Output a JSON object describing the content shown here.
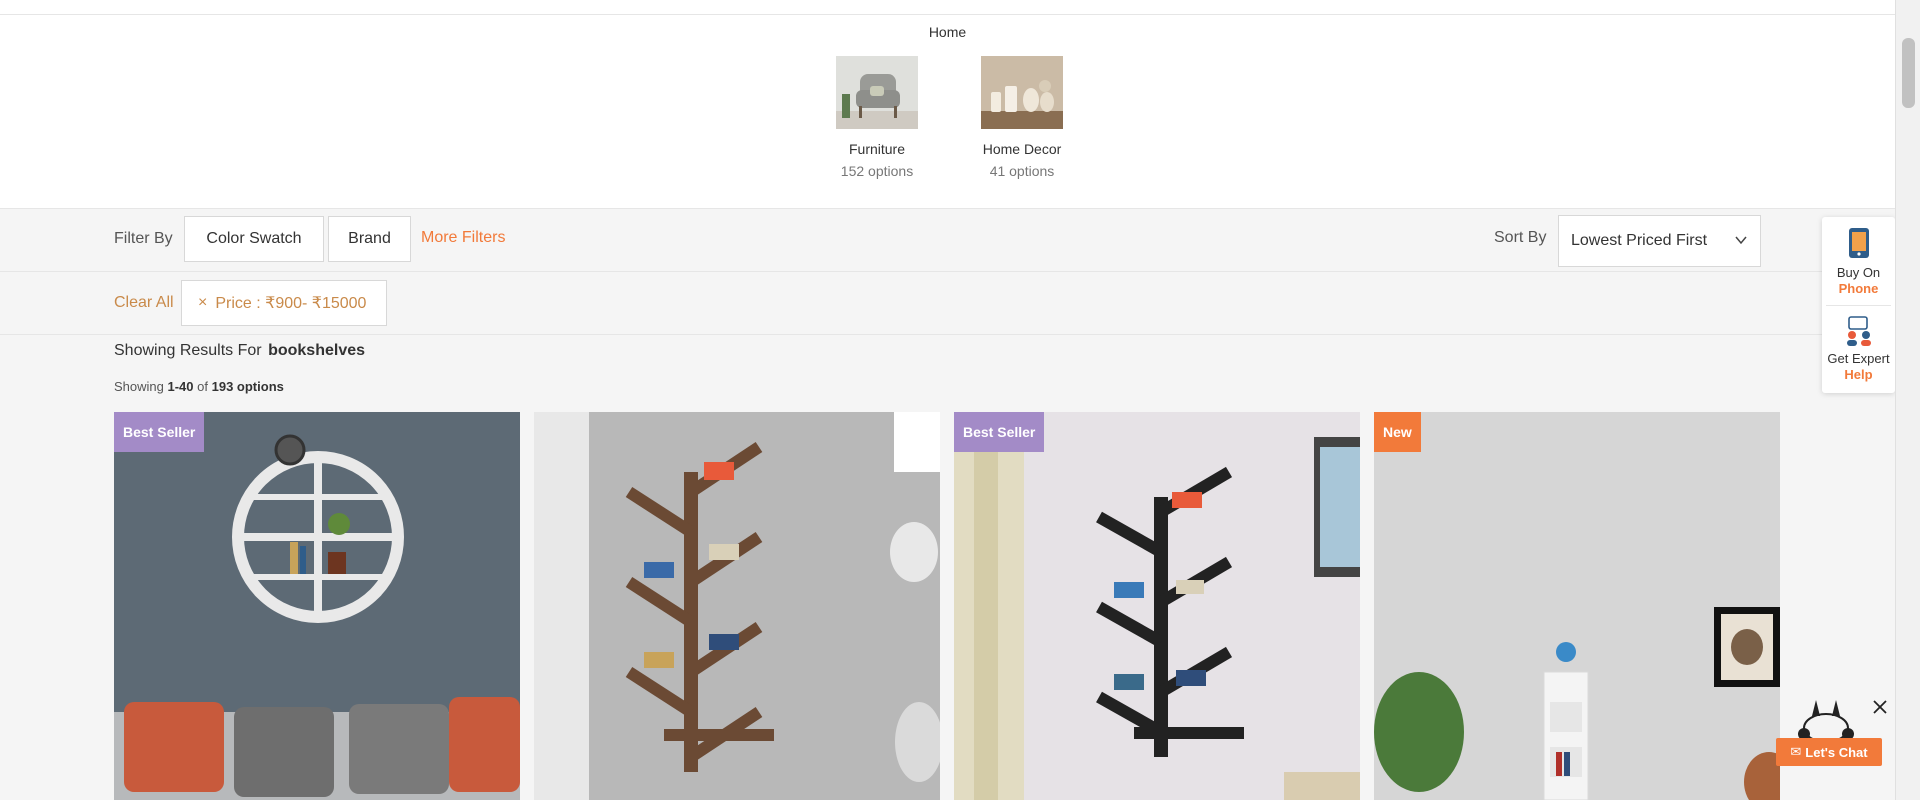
{
  "breadcrumb": {
    "home": "Home"
  },
  "categories": [
    {
      "name": "Furniture",
      "count": "152 options"
    },
    {
      "name": "Home Decor",
      "count": "41 options"
    }
  ],
  "filters": {
    "label": "Filter By",
    "buttons": [
      "Color Swatch",
      "Brand"
    ],
    "more": "More Filters"
  },
  "sort": {
    "label": "Sort By",
    "selected": "Lowest Priced First"
  },
  "applied": {
    "clear_all": "Clear All",
    "chip": "Price : ₹900- ₹15000",
    "chip_close": "×"
  },
  "results": {
    "prefix": "Showing Results For",
    "query": "bookshelves",
    "count_prefix": "Showing",
    "count_range": "1-40",
    "count_of": "of",
    "count_total": "193 options"
  },
  "products": [
    {
      "badge": "Best Seller",
      "badge_type": "seller"
    },
    {
      "badge": "",
      "badge_type": ""
    },
    {
      "badge": "Best Seller",
      "badge_type": "seller"
    },
    {
      "badge": "New",
      "badge_type": "new"
    }
  ],
  "side_panel": {
    "phone_top": "Buy On",
    "phone_accent": "Phone",
    "expert_top": "Get Expert",
    "expert_accent": "Help"
  },
  "chat": {
    "label": "Let's Chat"
  },
  "colors": {
    "accent": "#f27a3a",
    "badge_seller": "#a38bc7",
    "chip_text": "#c98a4a"
  },
  "icons": [
    "phone-icon",
    "expert-icon",
    "chevron-down-icon",
    "close-icon",
    "chat-icon"
  ]
}
